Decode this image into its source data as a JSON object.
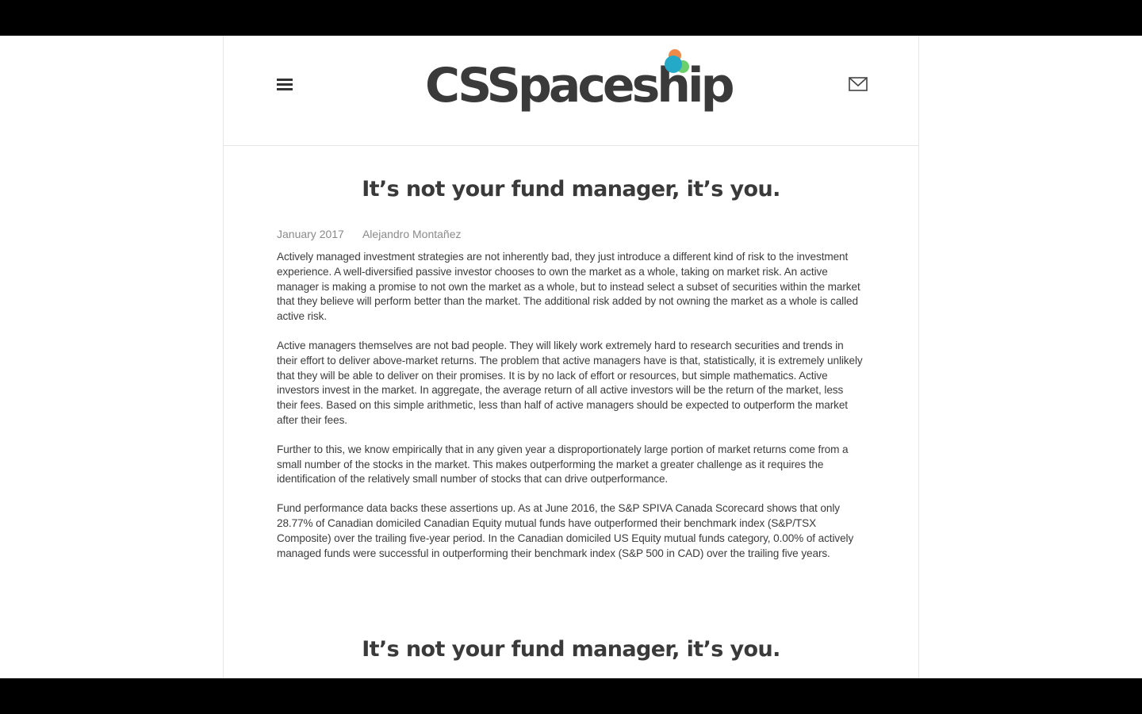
{
  "site": {
    "logo_text": "CSSpaceship",
    "logo_colors": [
      "#f08a4b",
      "#25a9c9",
      "#6ccf6c"
    ]
  },
  "header": {
    "menu_icon": "hamburger-menu-icon",
    "mail_icon": "envelope-icon"
  },
  "articles": [
    {
      "title": "It’s not your fund manager, it’s you.",
      "date": "January 2017",
      "author": "Alejandro Montañez",
      "paragraphs": [
        "Actively managed investment strategies are not inherently bad, they just introduce a different kind of risk to the investment experience. A well-diversified passive investor chooses to own the market as a whole, taking on market risk. An active manager is making a promise to not own the market as a whole, but to instead select a subset of securities within the market that they believe will perform better than the market. The additional risk added by not owning the market as a whole is called active risk.",
        "Active managers themselves are not bad people. They will likely work extremely hard to research securities and trends in their effort to deliver above-market returns. The problem that active managers have is that, statistically, it is extremely unlikely that they will be able to deliver on their promises. It is by no lack of effort or resources, but simple mathematics. Active investors invest in the market. In aggregate, the average return of all active investors will be the return of the market, less their fees. Based on this simple arithmetic, less than half of active managers should be expected to outperform the market after their fees.",
        "Further to this, we know empirically that in any given year a disproportionately large portion of market returns come from a small number of the stocks in the market. This makes outperforming the market a greater challenge as it requires the identification of the relatively small number of stocks that can drive outperformance.",
        "Fund performance data backs these assertions up. As at June 2016, the S&P SPIVA Canada Scorecard shows that only 28.77% of Canadian domiciled Canadian Equity mutual funds have outperformed their benchmark index (S&P/TSX Composite) over the trailing five-year period. In the Canadian domiciled US Equity mutual funds category, 0.00% of actively managed funds were successful in outperforming their benchmark index (S&P 500 in CAD) over the trailing five years."
      ]
    },
    {
      "title": "It’s not your fund manager, it’s you."
    }
  ]
}
